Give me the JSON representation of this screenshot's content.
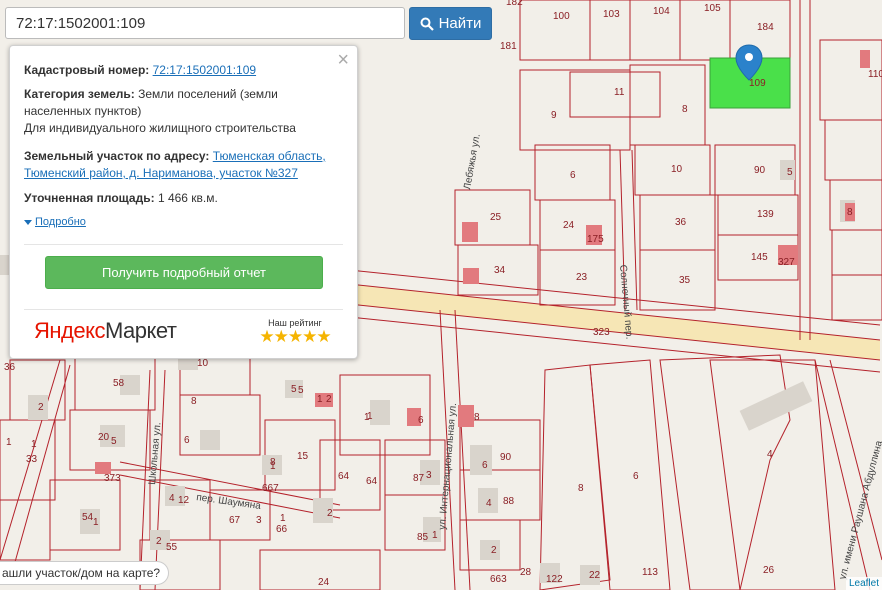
{
  "search": {
    "value": "72:17:1502001:109",
    "button_label": "Найти"
  },
  "popup": {
    "cadastre_label": "Кадастровый номер:",
    "cadastre_value": "72:17:1502001:109",
    "category_label": "Категория земель:",
    "category_value": "Земли поселений (земли населенных пунктов)",
    "category_use": "Для индивидуального жилищного строительства",
    "address_label": "Земельный участок по адресу:",
    "address_value": "Тюменская область, Тюменский район, д. Нариманова, участок №327",
    "area_label": "Уточненная площадь:",
    "area_value": "1 466 кв.м.",
    "more_label": "Подробно",
    "report_button": "Получить подробный отчет",
    "ad_logo_ya": "Яндекс",
    "ad_logo_market": "Маркет",
    "rating_label": "Наш рейтинг",
    "stars": "★★★★★"
  },
  "bottom_prompt": "ашли участок/дом на карте?",
  "attribution": "Leaflet",
  "map": {
    "streets": [
      "Лебяжья ул.",
      "Солнечный пер.",
      "ул. Интернациональная ул.",
      "Школьная ул.",
      "пер. Шаумяна",
      "ул. имени Раушана Абдуллина"
    ],
    "parcel_labels": [
      "182",
      "100",
      "103",
      "104",
      "105",
      "184",
      "181",
      "110",
      "11",
      "8",
      "9",
      "109",
      "6",
      "10",
      "90",
      "5",
      "25",
      "24",
      "36",
      "139",
      "8",
      "34",
      "23",
      "35",
      "145",
      "327",
      "323",
      "36",
      "58",
      "10",
      "6",
      "5",
      "2",
      "20",
      "5",
      "1",
      "33",
      "373",
      "12",
      "4",
      "67",
      "3",
      "66",
      "2",
      "54",
      "1",
      "2",
      "55",
      "15",
      "64",
      "64",
      "667",
      "87",
      "3",
      "85",
      "1",
      "90",
      "6",
      "88",
      "4",
      "2",
      "663",
      "28",
      "8",
      "6",
      "4",
      "26",
      "24",
      "122",
      "22",
      "113",
      "1",
      "8",
      "6",
      "1",
      "1",
      "5",
      "175",
      "2",
      "8",
      "8",
      "1",
      "1",
      "1",
      "1"
    ],
    "selected_parcel": "109",
    "colors": {
      "parcel_line": "#b4222b",
      "selected_fill": "#4ae04a",
      "marker": "#2b82cb",
      "road": "#f6e3a8"
    }
  }
}
